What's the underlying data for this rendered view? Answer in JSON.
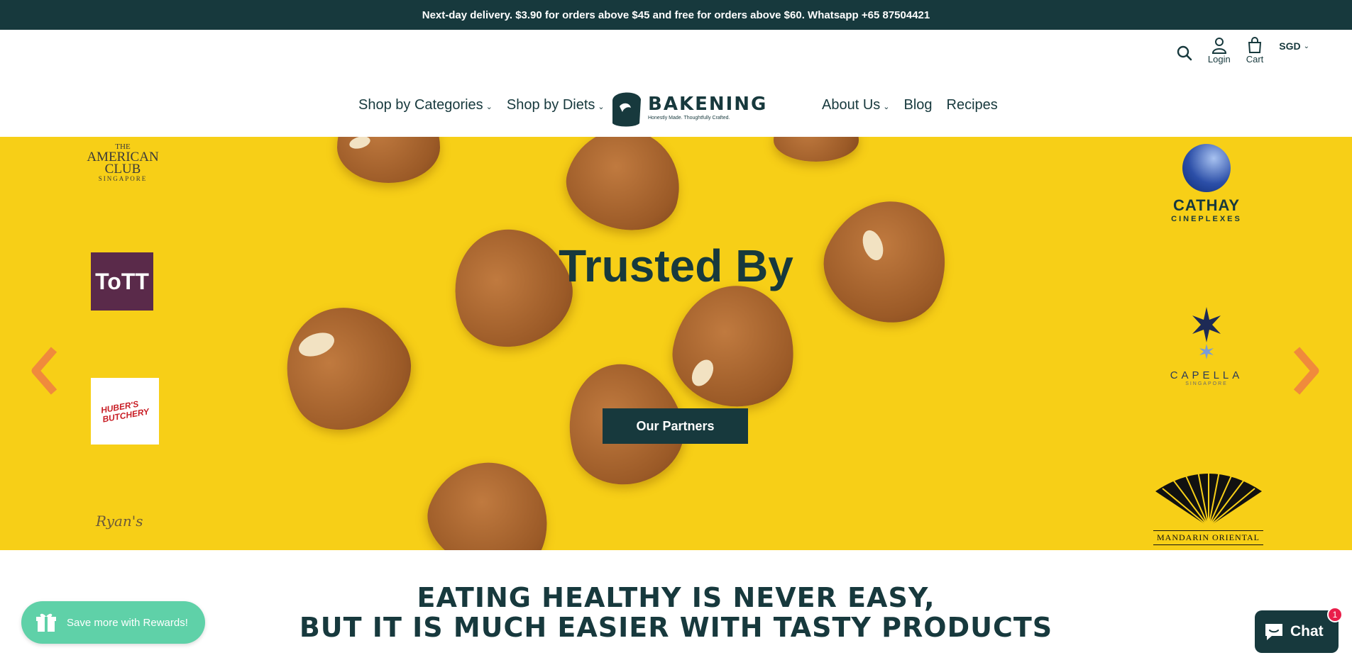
{
  "announcement": "Next-day delivery. $3.90 for orders above $45 and free for orders above $60. Whatsapp +65 87504421",
  "header": {
    "util": {
      "login": "Login",
      "cart": "Cart",
      "currency": "SGD"
    },
    "nav_left": [
      {
        "label": "Shop by Categories",
        "has_dropdown": true
      },
      {
        "label": "Shop by Diets",
        "has_dropdown": true
      }
    ],
    "nav_right": [
      {
        "label": "About Us",
        "has_dropdown": true
      },
      {
        "label": "Blog"
      },
      {
        "label": "Recipes"
      }
    ],
    "logo": {
      "name": "BAKENING",
      "tagline": "Honestly Made. Thoughtfully Crafted."
    }
  },
  "hero": {
    "title": "Trusted By",
    "button": "Our Partners",
    "background_color": "#f7cf17",
    "partner_logos": {
      "american_club": {
        "line1": "THE",
        "line2": "AMERICAN",
        "line3": "CLUB",
        "line4": "SINGAPORE"
      },
      "tott": "ToTT",
      "hubers": {
        "line1": "HUBER'S",
        "line2": "BUTCHERY"
      },
      "ryans": "Ryan's",
      "cathay": {
        "line1": "CATHAY",
        "line2": "CINEPLEXES"
      },
      "capella": {
        "line1": "CAPELLA",
        "line2": "SINGAPORE"
      },
      "mandarin": "MANDARIN ORIENTAL"
    }
  },
  "tagline": {
    "line1": "EATING HEALTHY IS NEVER EASY,",
    "line2": "BUT IT IS MUCH EASIER WITH TASTY PRODUCTS"
  },
  "rewards": {
    "label": "Save more with Rewards!"
  },
  "chat": {
    "label": "Chat",
    "badge": "1"
  },
  "colors": {
    "brand": "#17393d",
    "rewards": "#5fd1a8",
    "arrow": "#f08a3c",
    "badge": "#e91e4a"
  },
  "icons": [
    "search-icon",
    "user-icon",
    "cart-icon",
    "chevron-left-icon",
    "chevron-right-icon",
    "gift-icon",
    "chat-icon"
  ]
}
